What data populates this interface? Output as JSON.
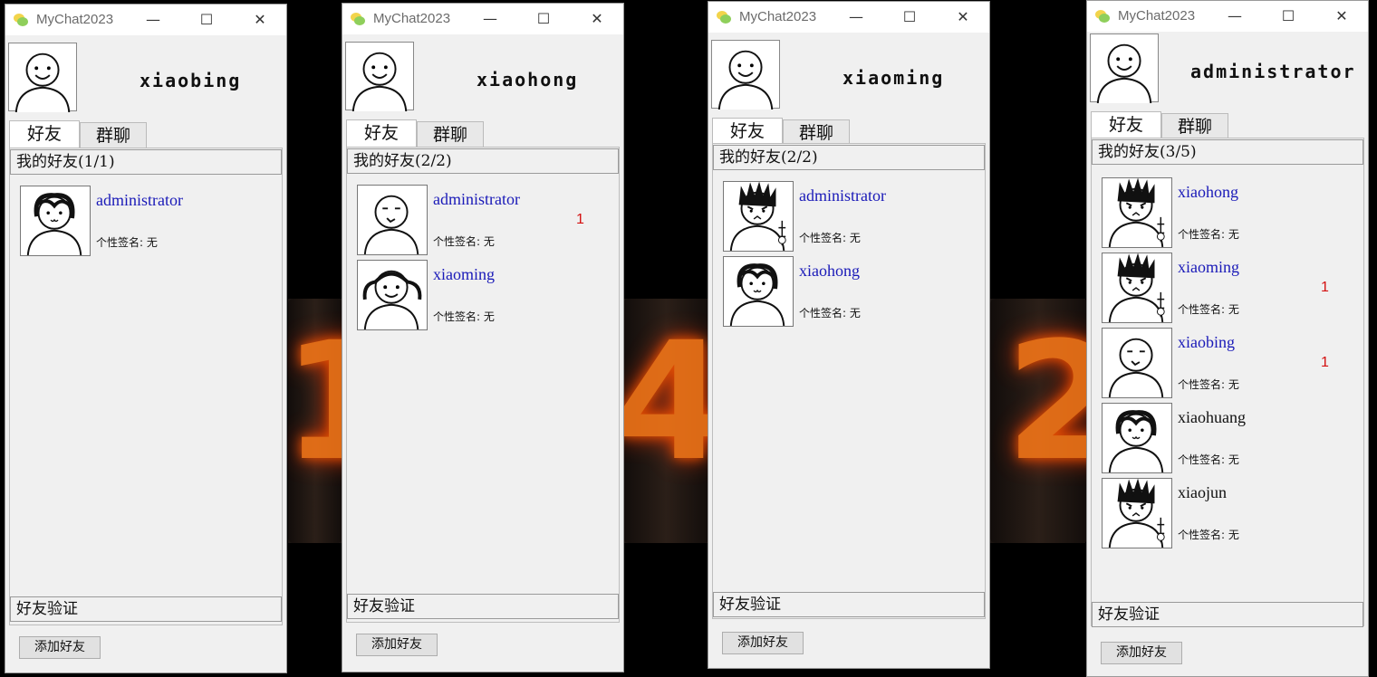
{
  "app_title": "MyChat2023",
  "window_controls": [
    "—",
    "☐",
    "✕"
  ],
  "background_digits": [
    "1",
    "4",
    "2"
  ],
  "tabs": {
    "friends": "好友",
    "groups": "群聊"
  },
  "friend_verify_label": "好友验证",
  "add_friend_label": "添加好友",
  "colors": {
    "online_name": "#1a1ab8",
    "offline_name": "#111111",
    "unread_badge": "#d41010",
    "window_bg": "#f0f0f0"
  },
  "windows": [
    {
      "username": "xiaobing",
      "group_label": "我的好友(1/1)",
      "friends": [
        {
          "name": "administrator",
          "signature": "个性签名: 无",
          "online": true,
          "unread": "",
          "avatar": "girl-messy-hair-icon"
        }
      ]
    },
    {
      "username": "xiaohong",
      "group_label": "我的好友(2/2)",
      "friends": [
        {
          "name": "administrator",
          "signature": "个性签名: 无",
          "online": true,
          "unread": "1",
          "avatar": "bald-face-icon"
        },
        {
          "name": "xiaoming",
          "signature": "个性签名: 无",
          "online": true,
          "unread": "",
          "avatar": "girl-pigtails-icon"
        }
      ]
    },
    {
      "username": "xiaoming",
      "group_label": "我的好友(2/2)",
      "friends": [
        {
          "name": "administrator",
          "signature": "个性签名: 无",
          "online": true,
          "unread": "",
          "avatar": "spiky-hair-angry-icon"
        },
        {
          "name": "xiaohong",
          "signature": "个性签名: 无",
          "online": true,
          "unread": "",
          "avatar": "girl-messy-hair-icon"
        }
      ]
    },
    {
      "username": "administrator",
      "group_label": "我的好友(3/5)",
      "friends": [
        {
          "name": "xiaohong",
          "signature": "个性签名: 无",
          "online": true,
          "unread": "",
          "avatar": "spiky-hair-angry-icon"
        },
        {
          "name": "xiaoming",
          "signature": "个性签名: 无",
          "online": true,
          "unread": "1",
          "avatar": "spiky-hair-angry-icon"
        },
        {
          "name": "xiaobing",
          "signature": "个性签名: 无",
          "online": true,
          "unread": "1",
          "avatar": "bald-face-icon"
        },
        {
          "name": "xiaohuang",
          "signature": "个性签名: 无",
          "online": false,
          "unread": "",
          "avatar": "girl-messy-hair-icon"
        },
        {
          "name": "xiaojun",
          "signature": "个性签名: 无",
          "online": false,
          "unread": "",
          "avatar": "spiky-hair-angry-icon"
        }
      ]
    }
  ]
}
